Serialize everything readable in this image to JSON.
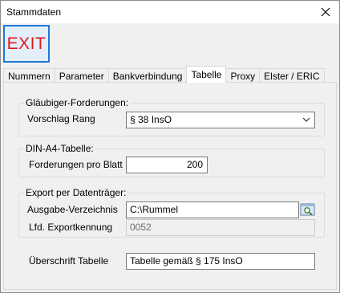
{
  "window": {
    "title": "Stammdaten"
  },
  "toolbar": {
    "exit_label": "EXIT"
  },
  "tabs": [
    {
      "label": "Nummern"
    },
    {
      "label": "Parameter"
    },
    {
      "label": "Bankverbindung"
    },
    {
      "label": "Tabelle",
      "active": true
    },
    {
      "label": "Proxy"
    },
    {
      "label": "Elster / ERIC"
    }
  ],
  "glaeubiger": {
    "legend": "Gläubiger-Forderungen:",
    "rang_label": "Vorschlag Rang",
    "rang_value": "§ 38 InsO"
  },
  "din": {
    "legend": "DIN-A4-Tabelle:",
    "forderungen_label": "Forderungen pro Blatt",
    "forderungen_value": "200"
  },
  "export": {
    "legend": "Export per Datenträger:",
    "verzeichnis_label": "Ausgabe-Verzeichnis",
    "verzeichnis_value": "C:\\Rummel",
    "kennung_label": "Lfd. Exportkennung",
    "kennung_value": "0052"
  },
  "ueberschrift": {
    "label": "Überschrift Tabelle",
    "value": "Tabelle gemäß § 175 InsO"
  }
}
